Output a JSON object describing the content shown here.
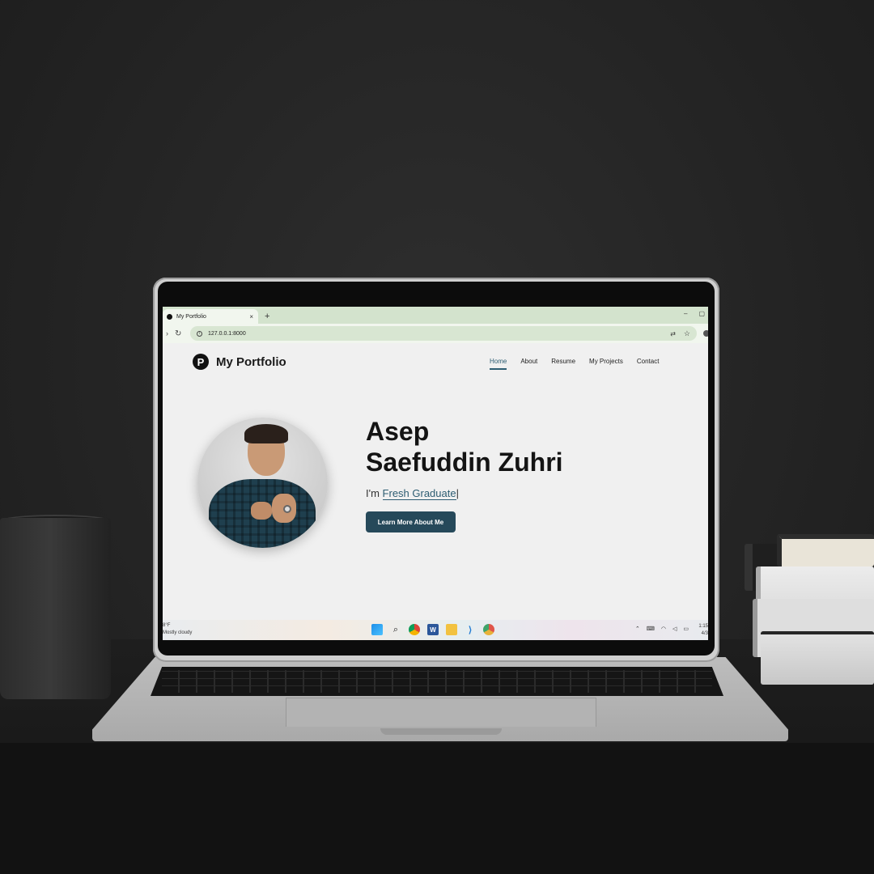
{
  "browser": {
    "tab_title": "My Portfolio",
    "tab_close": "×",
    "new_tab": "+",
    "window_min": "–",
    "window_restore": "▢",
    "url": "127.0.0.1:8000"
  },
  "site": {
    "logo_letter": "P",
    "logo_text": "My Portfolio",
    "nav": [
      {
        "label": "Home",
        "active": true
      },
      {
        "label": "About"
      },
      {
        "label": "Resume"
      },
      {
        "label": "My Projects"
      },
      {
        "label": "Contact"
      }
    ],
    "hero": {
      "name_line1": "Asep",
      "name_line2": "Saefuddin Zuhri",
      "role_prefix": "I'm ",
      "role_typed": "Fresh Graduate",
      "cta_label": "Learn More About Me"
    },
    "accent_color": "#2d5d72"
  },
  "taskbar": {
    "weather_temp": "8°F",
    "weather_desc": "Mostly cloudy",
    "icons": [
      "windows-start-icon",
      "search-icon",
      "chrome-icon",
      "word-icon",
      "file-explorer-icon",
      "vscode-icon",
      "chrome-canary-icon"
    ],
    "clock_time": "1:15",
    "clock_date": "4/3"
  }
}
